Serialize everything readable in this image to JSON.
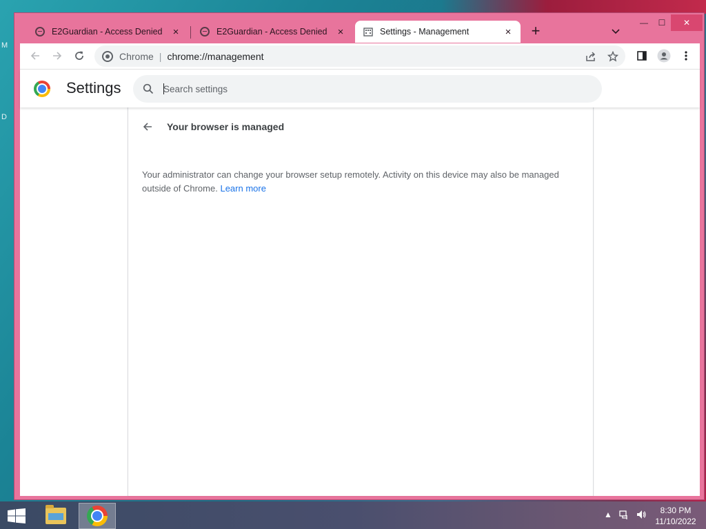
{
  "desktop": {
    "side_chars": [
      "M",
      "D"
    ]
  },
  "window": {
    "controls": {
      "minimize": "—",
      "maximize": "☐",
      "close": "✕"
    }
  },
  "tabs": [
    {
      "label": "E2Guardian - Access Denied",
      "icon": "globe-icon",
      "active": false
    },
    {
      "label": "E2Guardian - Access Denied",
      "icon": "globe-icon",
      "active": false
    },
    {
      "label": "Settings - Management",
      "icon": "building-icon",
      "active": true
    }
  ],
  "tabstrip": {
    "new_tab": "+",
    "menu": "⌄"
  },
  "omnibox": {
    "site": "Chrome",
    "separator": "|",
    "url": "chrome://management"
  },
  "settings": {
    "title": "Settings",
    "search_placeholder": "Search settings"
  },
  "management": {
    "title": "Your browser is managed",
    "description": "Your administrator can change your browser setup remotely. Activity on this device may also be managed outside of Chrome.",
    "link": "Learn more"
  },
  "taskbar": {
    "time": "8:30 PM",
    "date": "11/10/2022",
    "apps": [
      "file-explorer-icon",
      "chrome-icon"
    ]
  },
  "colors": {
    "window_frame": "#e8749c",
    "link": "#1a73e8"
  }
}
